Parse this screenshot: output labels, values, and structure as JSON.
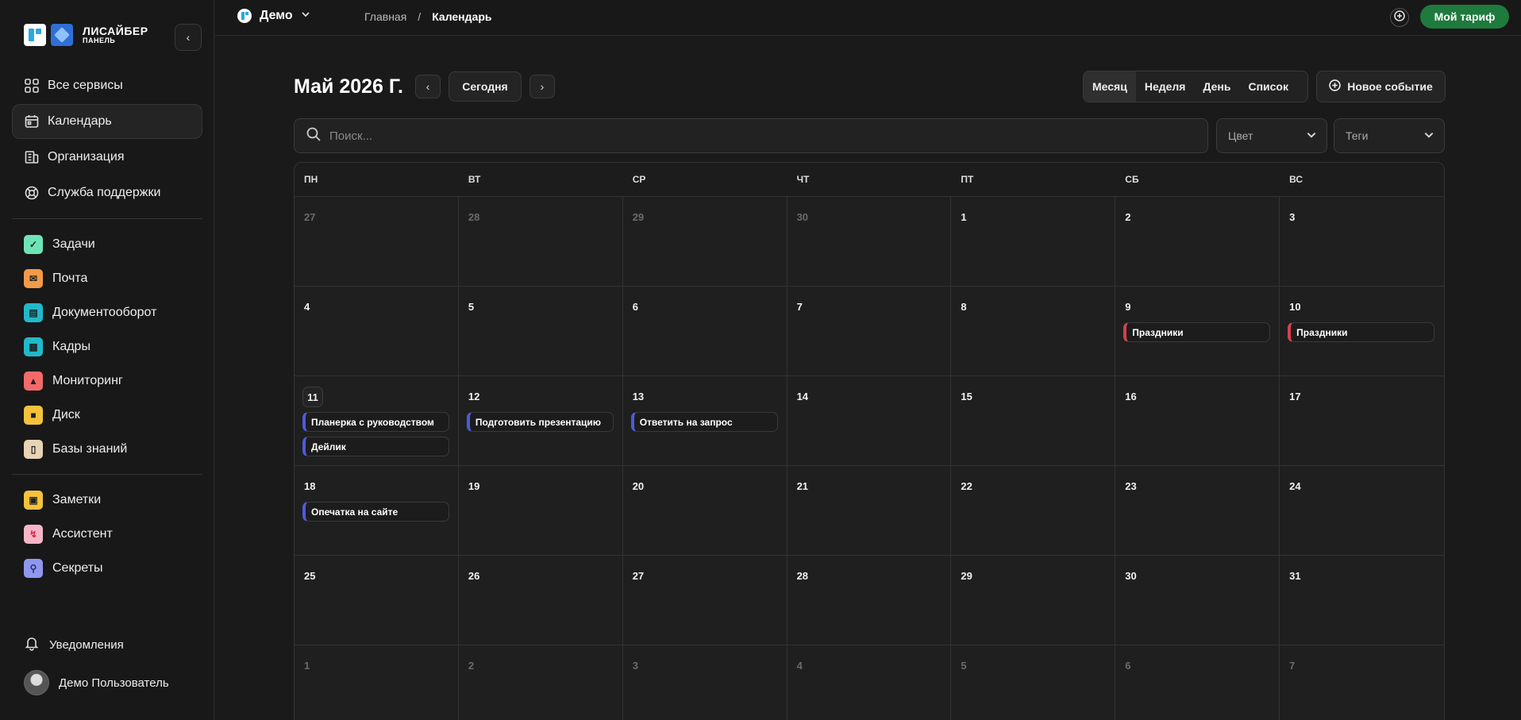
{
  "sidebar": {
    "brand_name": "ЛИСАЙБЕР",
    "brand_sub": "ПАНЕЛЬ",
    "nav": [
      {
        "label": "Все сервисы",
        "icon": "grid-icon"
      },
      {
        "label": "Календарь",
        "icon": "calendar-icon",
        "active": true
      },
      {
        "label": "Организация",
        "icon": "building-icon"
      },
      {
        "label": "Служба поддержки",
        "icon": "lifebuoy-icon"
      }
    ],
    "apps": [
      {
        "label": "Задачи",
        "icon": "check-icon",
        "color": "#6fe3b8"
      },
      {
        "label": "Почта",
        "icon": "mail-icon",
        "color": "#f29a4a"
      },
      {
        "label": "Документооборот",
        "icon": "document-icon",
        "color": "#21b9c9"
      },
      {
        "label": "Кадры",
        "icon": "people-icon",
        "color": "#21b9c9"
      },
      {
        "label": "Мониторинг",
        "icon": "alert-icon",
        "color": "#f26a6a"
      },
      {
        "label": "Диск",
        "icon": "folder-icon",
        "color": "#f5c23c"
      },
      {
        "label": "Базы знаний",
        "icon": "book-icon",
        "color": "#e7d3b5"
      }
    ],
    "tools": [
      {
        "label": "Заметки",
        "icon": "note-icon",
        "color": "#f5c23c"
      },
      {
        "label": "Ассистент",
        "icon": "bolt-icon",
        "color": "#f7b6c8"
      },
      {
        "label": "Секреты",
        "icon": "key-icon",
        "color": "#8f98ee"
      }
    ],
    "notifications": "Уведомления",
    "user": "Демо Пользователь"
  },
  "topbar": {
    "workspace": "Демо",
    "breadcrumb_home": "Главная",
    "breadcrumb_sep": "/",
    "breadcrumb_current": "Календарь",
    "tariff": "Мой тариф"
  },
  "calendar": {
    "title": "Май 2026 Г.",
    "today_label": "Сегодня",
    "views": [
      "Месяц",
      "Неделя",
      "День",
      "Список"
    ],
    "active_view": "Месяц",
    "new_event": "Новое событие",
    "search_placeholder": "Поиск...",
    "color_filter": "Цвет",
    "tags_filter": "Теги",
    "weekdays": [
      "ПН",
      "ВТ",
      "СР",
      "ЧТ",
      "ПТ",
      "СБ",
      "ВС"
    ],
    "days": [
      {
        "n": "27",
        "other": true
      },
      {
        "n": "28",
        "other": true
      },
      {
        "n": "29",
        "other": true
      },
      {
        "n": "30",
        "other": true
      },
      {
        "n": "1"
      },
      {
        "n": "2"
      },
      {
        "n": "3"
      },
      {
        "n": "4"
      },
      {
        "n": "5"
      },
      {
        "n": "6"
      },
      {
        "n": "7"
      },
      {
        "n": "8"
      },
      {
        "n": "9",
        "events": [
          {
            "title": "Праздники",
            "color": "red"
          }
        ]
      },
      {
        "n": "10",
        "events": [
          {
            "title": "Праздники",
            "color": "red"
          }
        ]
      },
      {
        "n": "11",
        "today": true,
        "events": [
          {
            "title": "Планерка с руководством",
            "color": "blue"
          },
          {
            "title": "Дейлик",
            "color": "blue"
          }
        ]
      },
      {
        "n": "12",
        "events": [
          {
            "title": "Подготовить презентацию",
            "color": "blue"
          }
        ]
      },
      {
        "n": "13",
        "events": [
          {
            "title": "Ответить на запрос",
            "color": "blue"
          }
        ]
      },
      {
        "n": "14"
      },
      {
        "n": "15"
      },
      {
        "n": "16"
      },
      {
        "n": "17"
      },
      {
        "n": "18",
        "events": [
          {
            "title": "Опечатка на сайте",
            "color": "blue"
          }
        ]
      },
      {
        "n": "19"
      },
      {
        "n": "20"
      },
      {
        "n": "21"
      },
      {
        "n": "22"
      },
      {
        "n": "23"
      },
      {
        "n": "24"
      },
      {
        "n": "25"
      },
      {
        "n": "26"
      },
      {
        "n": "27"
      },
      {
        "n": "28"
      },
      {
        "n": "29"
      },
      {
        "n": "30"
      },
      {
        "n": "31"
      },
      {
        "n": "1",
        "other": true
      },
      {
        "n": "2",
        "other": true
      },
      {
        "n": "3",
        "other": true
      },
      {
        "n": "4",
        "other": true
      },
      {
        "n": "5",
        "other": true
      },
      {
        "n": "6",
        "other": true
      },
      {
        "n": "7",
        "other": true
      }
    ]
  }
}
